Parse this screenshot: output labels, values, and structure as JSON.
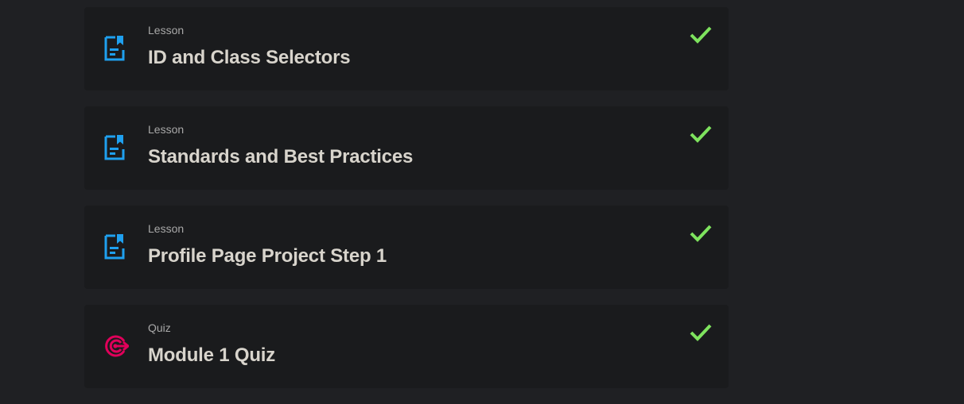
{
  "items": [
    {
      "kind": "Lesson",
      "title": "ID and Class Selectors",
      "icon": "lesson-document-icon",
      "completed": true
    },
    {
      "kind": "Lesson",
      "title": "Standards and Best Practices",
      "icon": "lesson-document-icon",
      "completed": true
    },
    {
      "kind": "Lesson",
      "title": "Profile Page Project Step 1",
      "icon": "lesson-document-icon",
      "completed": true
    },
    {
      "kind": "Quiz",
      "title": "Module 1 Quiz",
      "icon": "quiz-target-icon",
      "completed": true
    }
  ],
  "colors": {
    "background": "#1f2023",
    "card": "#1a1b1d",
    "lesson_icon": "#1fa0ef",
    "quiz_icon": "#e0005a",
    "check": "#7ee35e"
  }
}
